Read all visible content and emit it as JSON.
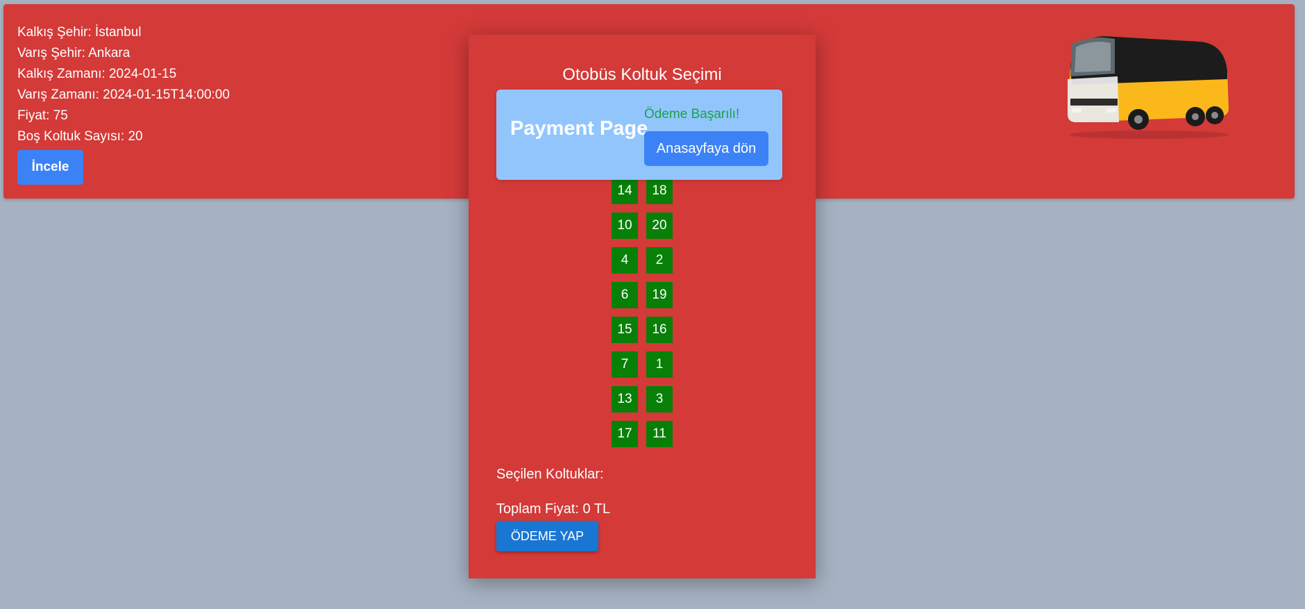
{
  "trip": {
    "lines": [
      "Kalkış Şehir: İstanbul",
      "Varış Şehir: Ankara",
      "Kalkış Zamanı: 2024-01-15",
      "Varış Zamanı: 2024-01-15T14:00:00",
      "Fiyat: 75",
      "Boş Koltuk Sayısı: 20"
    ],
    "inspect_button": "İncele"
  },
  "seat_selection": {
    "title": "Otobüs Koltuk Seçimi",
    "seats": [
      "14",
      "18",
      "10",
      "20",
      "4",
      "2",
      "6",
      "19",
      "15",
      "16",
      "7",
      "1",
      "13",
      "3",
      "17",
      "11"
    ],
    "selected_label": "Seçilen Koltuklar:",
    "total_label": "Toplam Fiyat: 0 TL",
    "pay_button": "ÖDEME YAP",
    "seat_color": "#088008"
  },
  "payment": {
    "title": "Payment Page",
    "status": "Ödeme Başarılı!",
    "home_button": "Anasayfaya dön"
  },
  "colors": {
    "background": "#a6b2c2",
    "card": "#d33a38",
    "accent_blue": "#3b82f6",
    "payment_box": "#93c5fd",
    "success_green": "#16a34a"
  }
}
